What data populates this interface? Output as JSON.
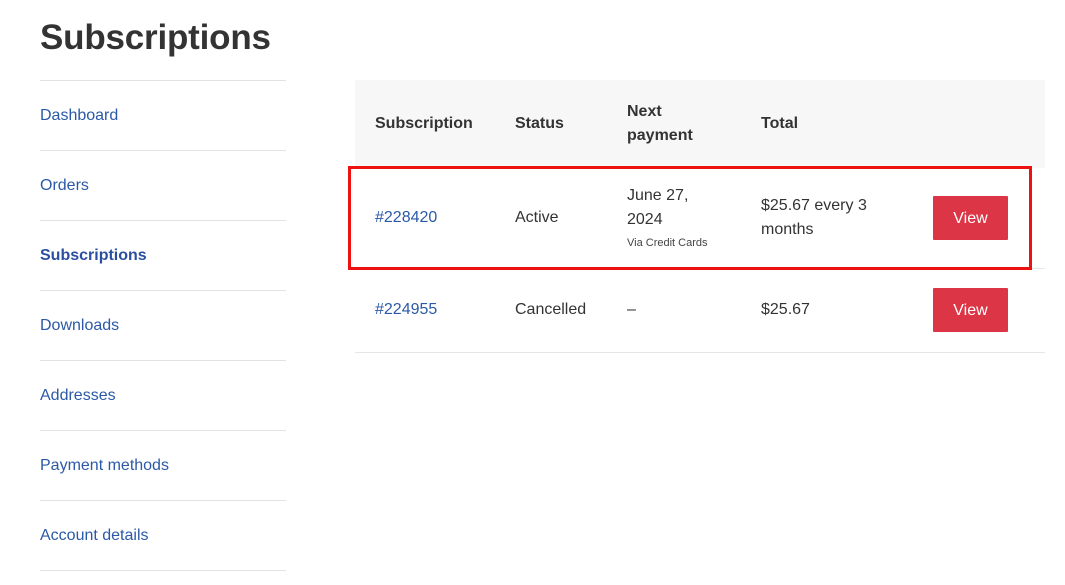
{
  "page": {
    "title": "Subscriptions"
  },
  "sidebar": {
    "items": [
      {
        "label": "Dashboard",
        "active": false
      },
      {
        "label": "Orders",
        "active": false
      },
      {
        "label": "Subscriptions",
        "active": true
      },
      {
        "label": "Downloads",
        "active": false
      },
      {
        "label": "Addresses",
        "active": false
      },
      {
        "label": "Payment methods",
        "active": false
      },
      {
        "label": "Account details",
        "active": false
      }
    ]
  },
  "table": {
    "headers": {
      "subscription": "Subscription",
      "status": "Status",
      "next_payment_line1": "Next",
      "next_payment_line2": "payment",
      "total": "Total"
    },
    "rows": [
      {
        "id": "#228420",
        "status": "Active",
        "next_payment_line1": "June 27,",
        "next_payment_line2": "2024",
        "payment_via": "Via Credit Cards",
        "total_line1": "$25.67 every 3",
        "total_line2": "months",
        "action": "View",
        "highlighted": true
      },
      {
        "id": "#224955",
        "status": "Cancelled",
        "next_payment": "–",
        "total": "$25.67",
        "action": "View",
        "highlighted": false
      }
    ]
  },
  "colors": {
    "link": "#2b59a7",
    "button": "#dc3545",
    "highlight": "#ee1111",
    "header_bg": "#f7f7f7"
  }
}
